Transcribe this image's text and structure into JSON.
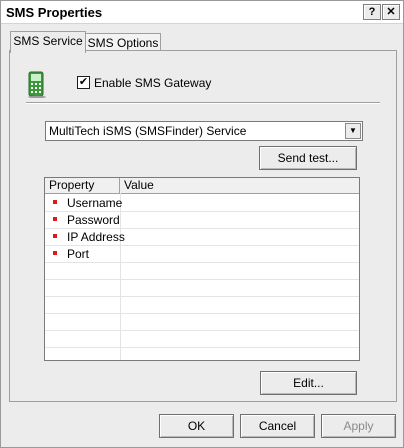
{
  "window": {
    "title": "SMS Properties",
    "help_glyph": "?",
    "close_glyph": "✕"
  },
  "tabs": [
    {
      "label": "SMS Service",
      "active": true
    },
    {
      "label": "SMS Options",
      "active": false
    }
  ],
  "gateway": {
    "enable_label": "Enable SMS Gateway",
    "enabled": true,
    "check_glyph": "✔"
  },
  "service": {
    "selected": "MultiTech iSMS (SMSFinder) Service",
    "dropdown_glyph": "▼"
  },
  "buttons": {
    "send_test": "Send test...",
    "edit": "Edit...",
    "ok": "OK",
    "cancel": "Cancel",
    "apply": "Apply"
  },
  "grid": {
    "columns": [
      "Property",
      "Value"
    ],
    "rows": [
      {
        "property": "Username",
        "value": ""
      },
      {
        "property": "Password",
        "value": ""
      },
      {
        "property": "IP Address",
        "value": ""
      },
      {
        "property": "Port",
        "value": ""
      }
    ]
  },
  "colors": {
    "accent_marker": "#e01a1a",
    "phone_body": "#3a9a3a"
  }
}
